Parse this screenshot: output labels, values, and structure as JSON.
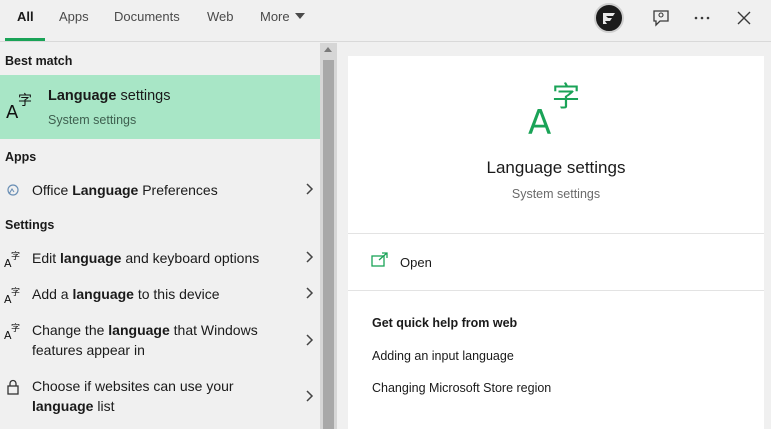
{
  "tabs": [
    {
      "label": "All",
      "active": true
    },
    {
      "label": "Apps"
    },
    {
      "label": "Documents"
    },
    {
      "label": "Web"
    },
    {
      "label": "More"
    }
  ],
  "topbar": {
    "avatar_icon": "account-avatar-icon",
    "feedback_icon": "feedback-icon",
    "more_icon": "ellipsis-icon",
    "close_icon": "close-icon"
  },
  "sections": {
    "best_match": "Best match",
    "apps": "Apps",
    "settings": "Settings"
  },
  "best_match": {
    "title_bold": "Language",
    "title_rest": " settings",
    "subtitle": "System settings",
    "icon": "language-icon"
  },
  "apps": [
    {
      "pre": "Office ",
      "bold": "Language",
      "post": " Preferences",
      "icon": "office-language-icon"
    }
  ],
  "settings": [
    {
      "pre": "Edit ",
      "bold": "language",
      "post": " and keyboard options",
      "icon": "language-icon"
    },
    {
      "pre": "Add a ",
      "bold": "language",
      "post": " to this device",
      "icon": "language-icon"
    },
    {
      "pre": "Change the ",
      "bold": "language",
      "post": " that Windows features appear in",
      "icon": "language-icon"
    },
    {
      "pre": "Choose if websites can use your ",
      "bold": "language",
      "post": " list",
      "icon": "lock-icon"
    }
  ],
  "preview": {
    "title": "Language settings",
    "subtitle": "System settings",
    "open_label": "Open",
    "help_heading": "Get quick help from web",
    "help_links": [
      "Adding an input language",
      "Changing Microsoft Store region"
    ]
  },
  "colors": {
    "accent": "#1aa357",
    "best_match_bg": "#a8e6c6"
  }
}
